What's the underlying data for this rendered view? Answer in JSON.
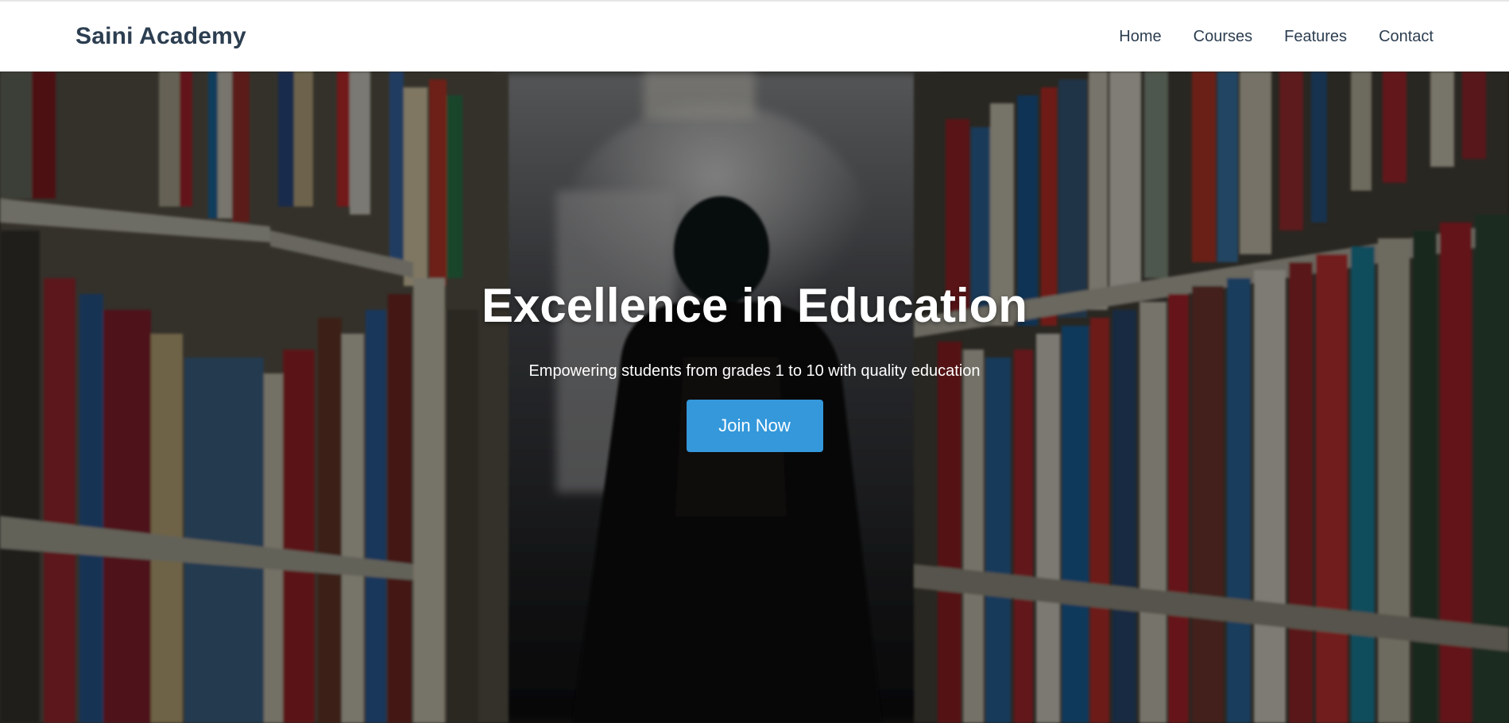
{
  "header": {
    "brand": "Saini Academy",
    "nav": [
      {
        "label": "Home"
      },
      {
        "label": "Courses"
      },
      {
        "label": "Features"
      },
      {
        "label": "Contact"
      }
    ]
  },
  "hero": {
    "title": "Excellence in Education",
    "subtitle": "Empowering students from grades 1 to 10 with quality education",
    "cta_label": "Join Now",
    "background_image": "library-bookshelves-photo"
  },
  "colors": {
    "brand_text": "#2c3e50",
    "cta_background": "#3498db",
    "header_background": "#ffffff"
  }
}
